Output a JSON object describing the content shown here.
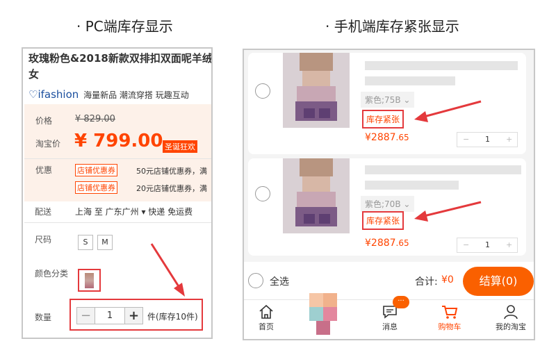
{
  "headings": {
    "pc": "· PC端库存显示",
    "mobile": "· 手机端库存紧张显示"
  },
  "pc": {
    "title_line1": "玫瑰粉色&2018新款双排扣双面呢羊绒",
    "title_line2": "女",
    "brand_name": "ifashion",
    "brand_tags": "海量新品 潮流穿搭 玩趣互动",
    "price_label": "价格",
    "original_price": "¥ 829.00",
    "taobao_price_label": "淘宝价",
    "sale_price": "¥ 799.00",
    "promo_tag": "圣诞狂欢",
    "discount_label": "优惠",
    "coupons": [
      {
        "tag": "店铺优惠券",
        "desc": "50元店铺优惠券，满"
      },
      {
        "tag": "店铺优惠券",
        "desc": "20元店铺优惠券，满"
      }
    ],
    "shipping_label": "配送",
    "shipping_value": "上海 至  广东广州 ▾   快递 免运费",
    "size_label": "尺码",
    "sizes": [
      "S",
      "M"
    ],
    "color_label": "颜色分类",
    "quantity_label": "数量",
    "quantity": "1",
    "minus": "−",
    "plus": "+",
    "stock_text": "件(库存10件)"
  },
  "mobile": {
    "items": [
      {
        "sku": "紫色;75B",
        "stock": "库存紧张",
        "price_int": "¥2887",
        "price_dec": ".65",
        "qty": "1",
        "minus": "−",
        "plus": "+"
      },
      {
        "sku": "紫色;70B",
        "stock": "库存紧张",
        "price_int": "¥2887",
        "price_dec": ".65",
        "qty": "1",
        "minus": "−",
        "plus": "+"
      }
    ],
    "select_all": "全选",
    "total_label": "合计:",
    "total_value": "¥0",
    "settle_button": "结算(0)",
    "tabs": [
      {
        "label": "首页",
        "icon": "home-icon"
      },
      {
        "label": "消息",
        "icon": "message-icon",
        "badge": "···"
      },
      {
        "label": "购物车",
        "icon": "cart-icon"
      },
      {
        "label": "我的淘宝",
        "icon": "user-icon"
      }
    ],
    "colors": {
      "accent": "#ff4400",
      "settle": "#fa6000",
      "highlight": "#e4393c"
    }
  }
}
